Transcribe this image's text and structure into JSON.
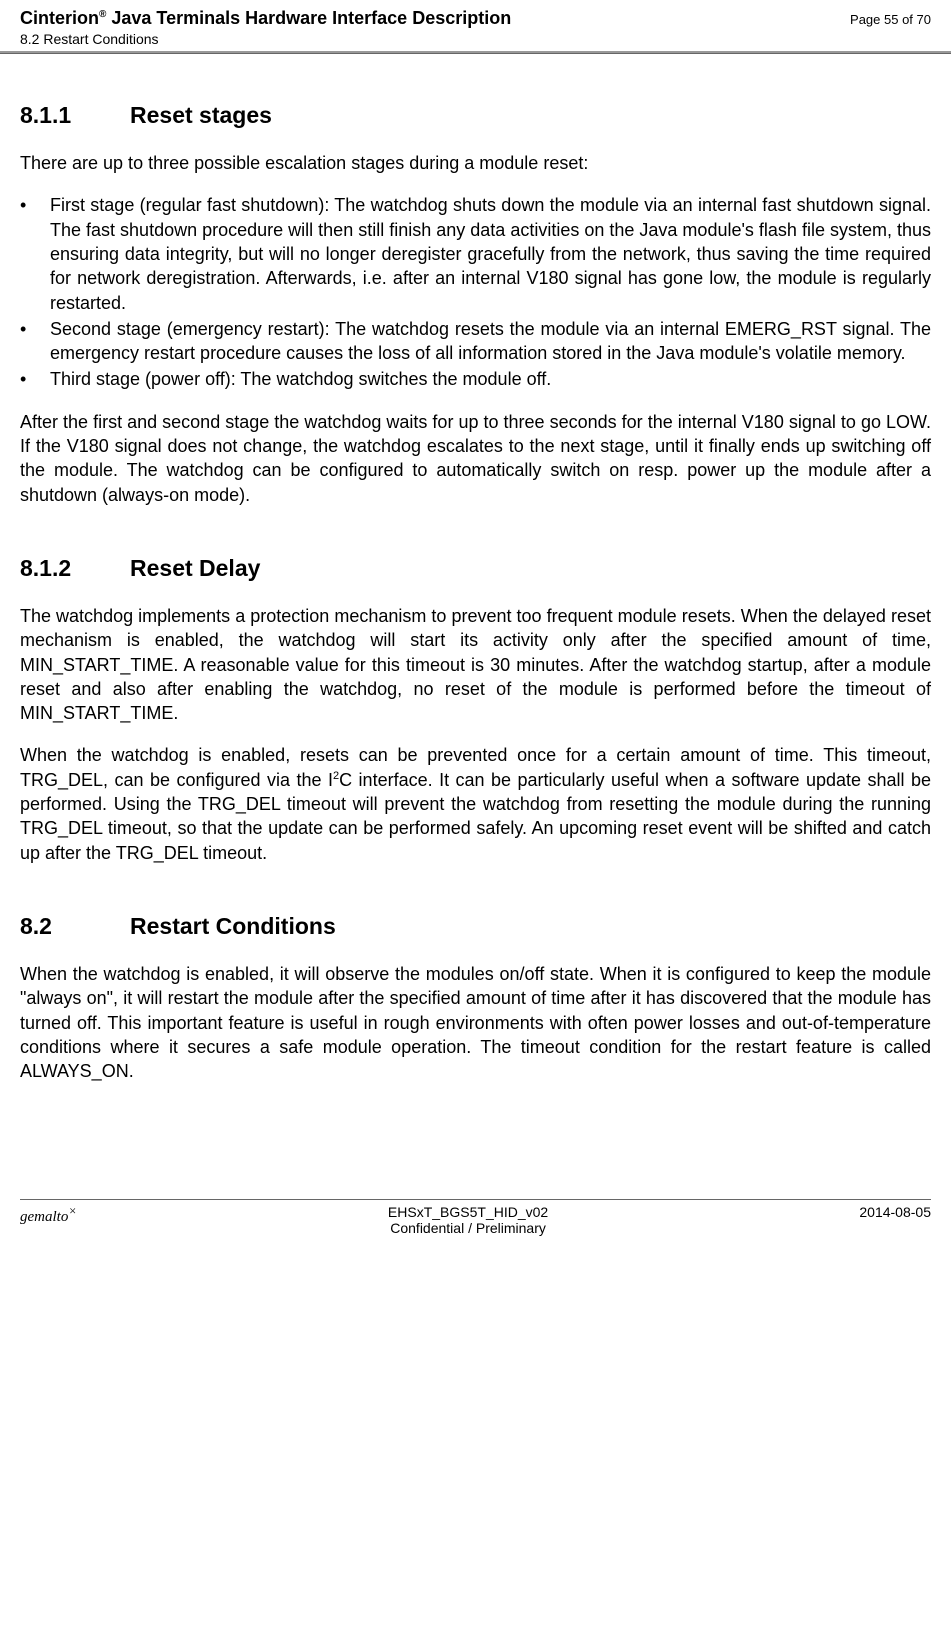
{
  "header": {
    "title_main": "Cinterion",
    "title_reg": "®",
    "title_rest": " Java Terminals Hardware Interface Description",
    "subtitle": "8.2 Restart Conditions",
    "page_info": "Page 55 of 70"
  },
  "sections": {
    "s1": {
      "num": "8.1.1",
      "title": "Reset stages",
      "intro": "There are up to three possible escalation stages during a module reset:",
      "bullets": [
        "First stage (regular fast shutdown): The watchdog shuts down the module via an internal fast shutdown signal. The fast shutdown procedure will then still finish any data activities on the Java module's flash file system, thus ensuring data integrity, but will no longer deregister gracefully from the network, thus saving the time required for network deregistration. Afterwards, i.e. after an internal V180 signal has gone low, the module is regularly restarted.",
        "Second stage (emergency restart): The watchdog resets the module via an internal EMERG_RST signal. The emergency restart procedure causes the loss of all information stored in the Java module's volatile memory.",
        "Third stage (power off): The watchdog switches the module off."
      ],
      "after": "After the first and second stage the watchdog waits for up to three seconds for the internal V180 signal to go LOW. If the V180 signal does not change, the watchdog escalates to the next stage, until it finally ends up switching off the module. The watchdog can be configured to automatically switch on resp. power up the module after a shutdown (always-on mode)."
    },
    "s2": {
      "num": "8.1.2",
      "title": "Reset Delay",
      "p1": "The watchdog implements a protection mechanism to prevent too frequent module resets. When the delayed reset mechanism is enabled, the watchdog will start its activity only after the specified amount of time, MIN_START_TIME. A reasonable value for this timeout is 30 minutes. After the watchdog startup, after a module reset and also after enabling the watchdog, no reset of the module is performed before the timeout of MIN_START_TIME.",
      "p2_a": "When the watchdog is enabled, resets can be prevented once for a certain amount of time. This timeout, TRG_DEL, can be configured via the I",
      "p2_b": "C interface. It can be particularly useful when a software update shall be performed. Using the TRG_DEL timeout will prevent the watchdog from resetting the module during the running TRG_DEL timeout, so that the update can be performed safely. An upcoming reset event will be shifted and catch up after the TRG_DEL timeout."
    },
    "s3": {
      "num": "8.2",
      "title": "Restart Conditions",
      "p1": "When the watchdog is enabled, it will observe the modules on/off state. When it is configured to keep the module \"always on\", it will restart the module after the specified amount of time after it has discovered that the module has turned off. This important feature is useful in rough environments with often power losses and out-of-temperature conditions where it secures a safe module operation. The timeout condition for the restart feature is called ALWAYS_ON."
    }
  },
  "footer": {
    "logo": "gemalto",
    "logo_sup": "×",
    "doc_id": "EHSxT_BGS5T_HID_v02",
    "confidential": "Confidential / Preliminary",
    "date": "2014-08-05"
  }
}
